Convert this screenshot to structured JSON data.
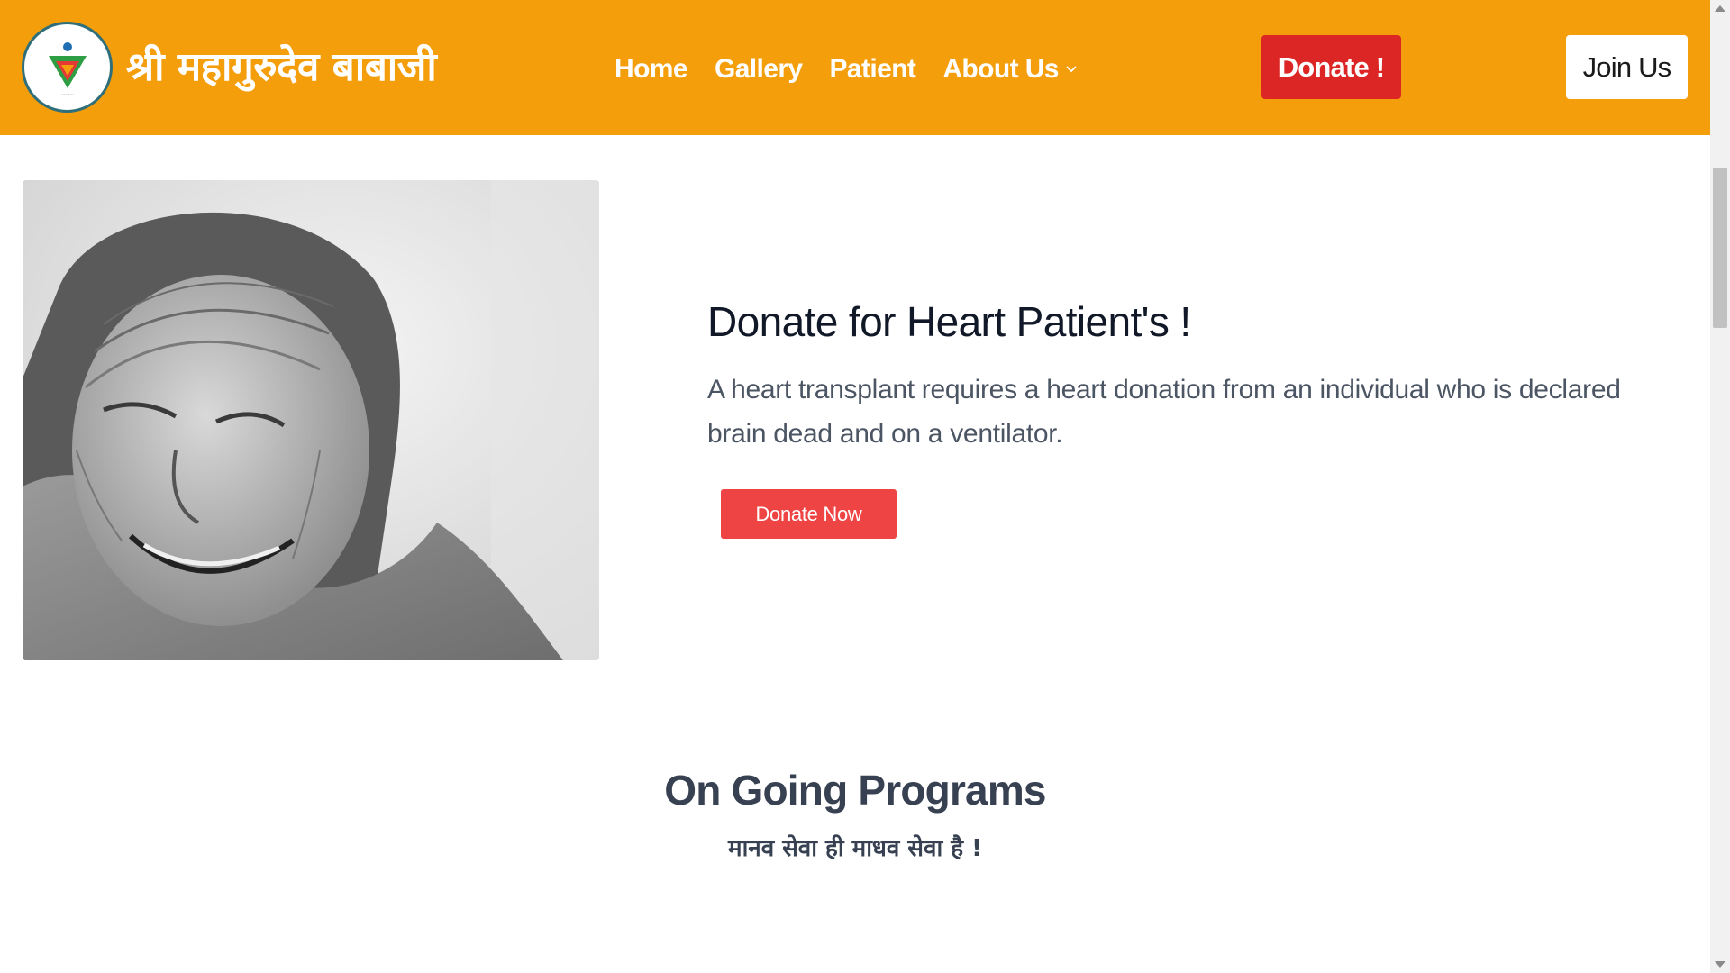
{
  "header": {
    "brand": "श्री महागुरुदेव बाबाजी",
    "nav": [
      {
        "label": "Home"
      },
      {
        "label": "Gallery"
      },
      {
        "label": "Patient"
      },
      {
        "label": "About Us"
      }
    ],
    "donate_label": "Donate !",
    "join_label": "Join Us"
  },
  "hero": {
    "title": "Donate for Heart Patient's !",
    "text": "A heart transplant requires a heart donation from an individual who is declared brain dead and on a ventilator.",
    "button_label": "Donate Now"
  },
  "programs": {
    "title": "On Going Programs",
    "subtitle": "मानव सेवा ही माधव सेवा है !"
  },
  "colors": {
    "header_bg": "#f59e0b",
    "donate_header": "#dc2626",
    "donate_now": "#ef4444"
  }
}
